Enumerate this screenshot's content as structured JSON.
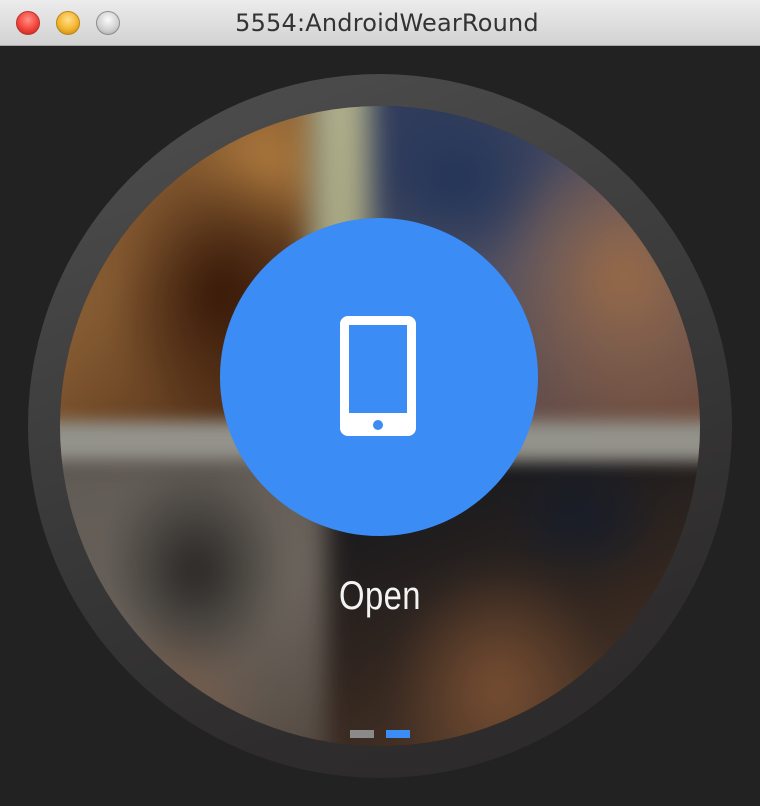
{
  "window": {
    "title": "5554:AndroidWearRound"
  },
  "action": {
    "label": "Open",
    "icon": "phone-icon",
    "accent_color": "#3b8cf5"
  },
  "pager": {
    "page_count": 2,
    "current_page": 2,
    "active_color": "#3b8cf5",
    "inactive_color": "#8a8a8a"
  }
}
